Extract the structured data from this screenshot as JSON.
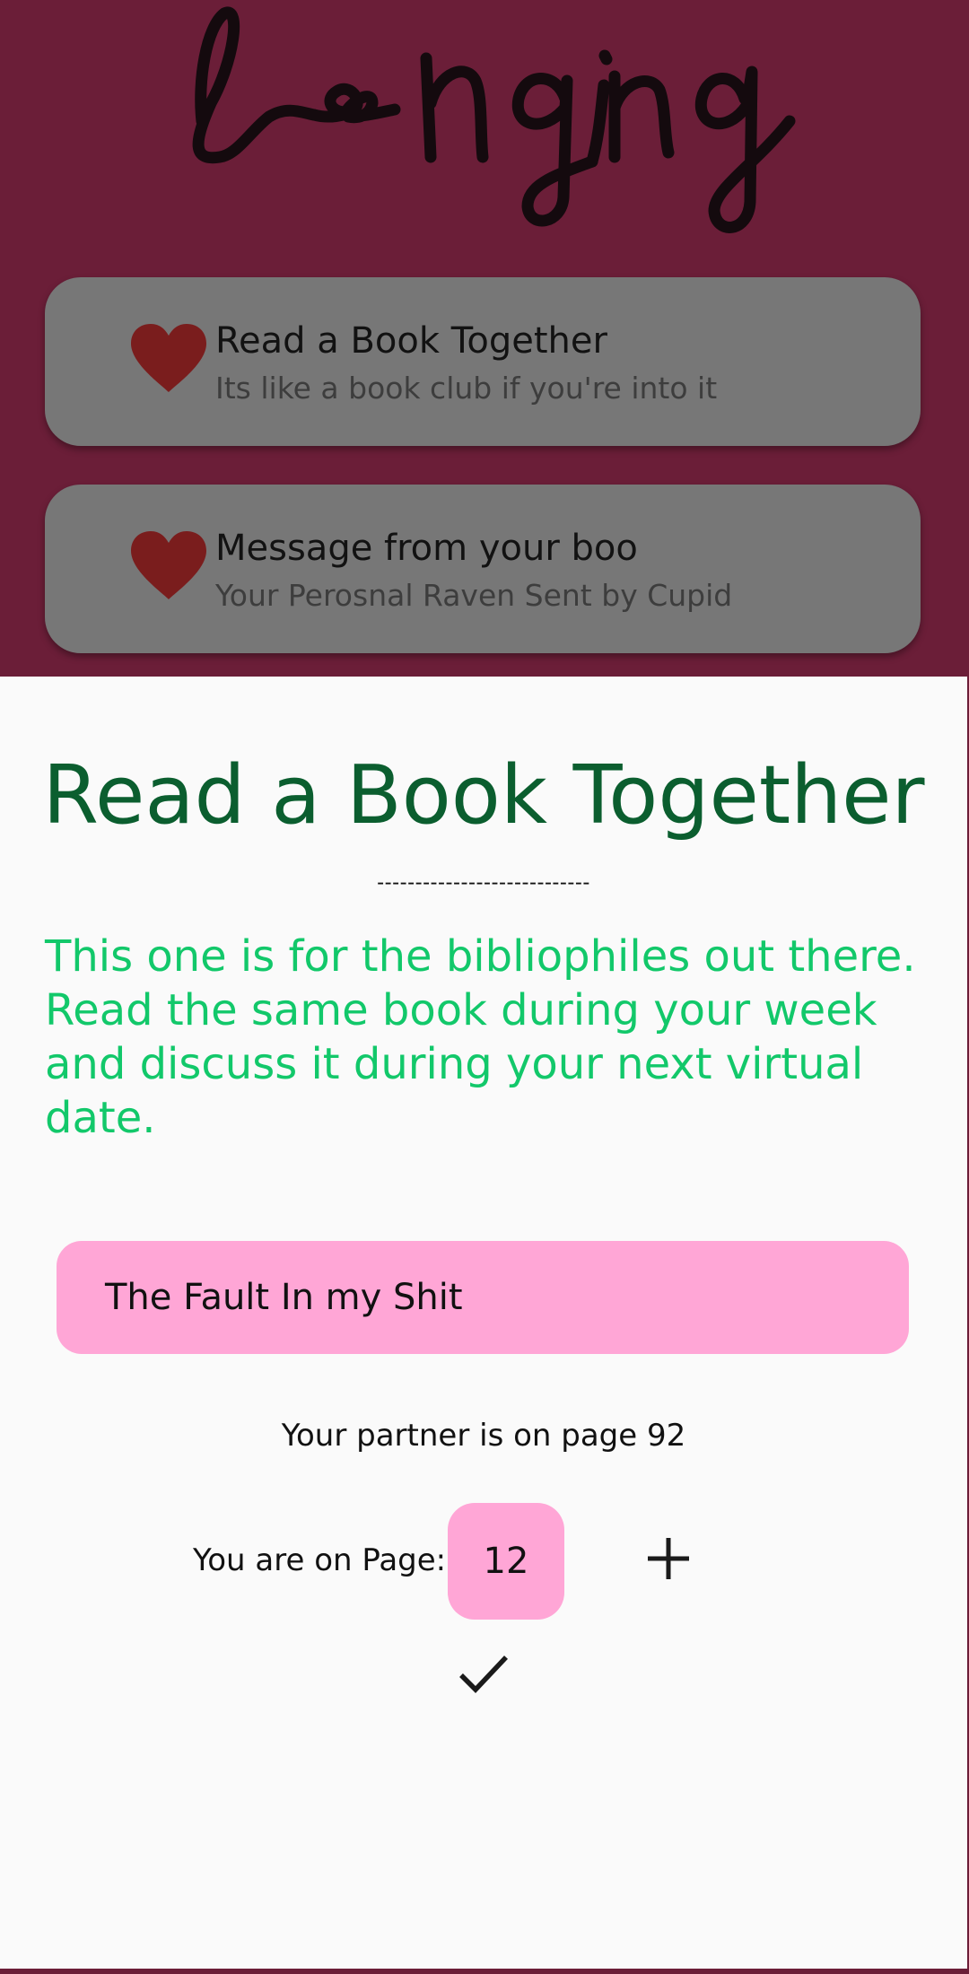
{
  "app": {
    "logo_text": "longing"
  },
  "cards": [
    {
      "title": "Read a Book Together",
      "subtitle": "Its like a book club if you're into it",
      "icon": "heart-icon"
    },
    {
      "title": "Message from your boo",
      "subtitle": "Your Perosnal Raven Sent by Cupid",
      "icon": "heart-icon"
    }
  ],
  "sheet": {
    "title": "Read a Book Together",
    "divider": "----------------------------",
    "description": "This one is for the bibliophiles out there. Read the same book during your week and discuss it during your next virtual date.",
    "book_title": "The Fault In my Shit",
    "partner_status": "Your partner is on page 92",
    "page_label": "You are on Page:",
    "page_value": "12",
    "plus_icon": "plus-icon",
    "check_icon": "check-icon"
  },
  "colors": {
    "header_bg": "#6b1e38",
    "card_bg": "#777777",
    "heart": "#7a1d1d",
    "sheet_bg": "#fafafa",
    "title_green": "#0b5e2f",
    "description_green": "#12c86a",
    "pink_field": "#ffa6d6"
  }
}
